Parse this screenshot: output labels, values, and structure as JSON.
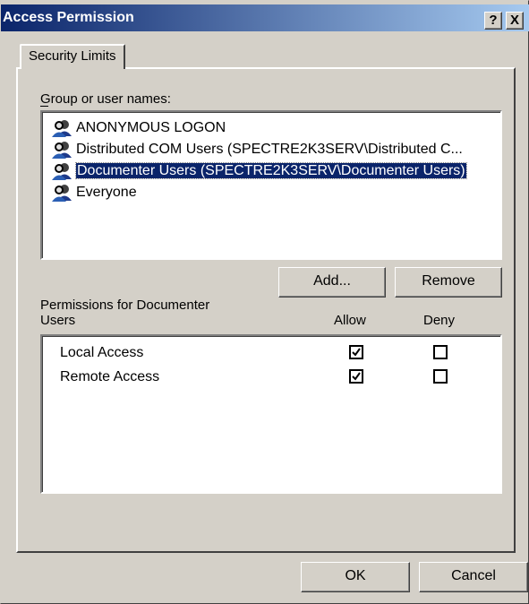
{
  "window": {
    "title": "Access Permission",
    "help_button": "?",
    "close_button": "X"
  },
  "tab": {
    "label": "Security Limits"
  },
  "group": {
    "label": "Group or user names:",
    "items": [
      {
        "label": "ANONYMOUS LOGON",
        "selected": false
      },
      {
        "label": "Distributed COM Users (SPECTRE2K3SERV\\Distributed C...",
        "selected": false
      },
      {
        "label": "Documenter Users (SPECTRE2K3SERV\\Documenter Users)",
        "selected": true
      },
      {
        "label": "Everyone",
        "selected": false
      }
    ],
    "icon": "user-group-icon"
  },
  "buttons": {
    "add": "Add...",
    "remove": "Remove",
    "ok": "OK",
    "cancel": "Cancel"
  },
  "permissions": {
    "label_line1": "Permissions for Documenter",
    "label_line2": "Users",
    "allow_header": "Allow",
    "deny_header": "Deny",
    "rows": [
      {
        "label": "Local Access",
        "allow": true,
        "deny": false
      },
      {
        "label": "Remote Access",
        "allow": true,
        "deny": false
      }
    ]
  }
}
